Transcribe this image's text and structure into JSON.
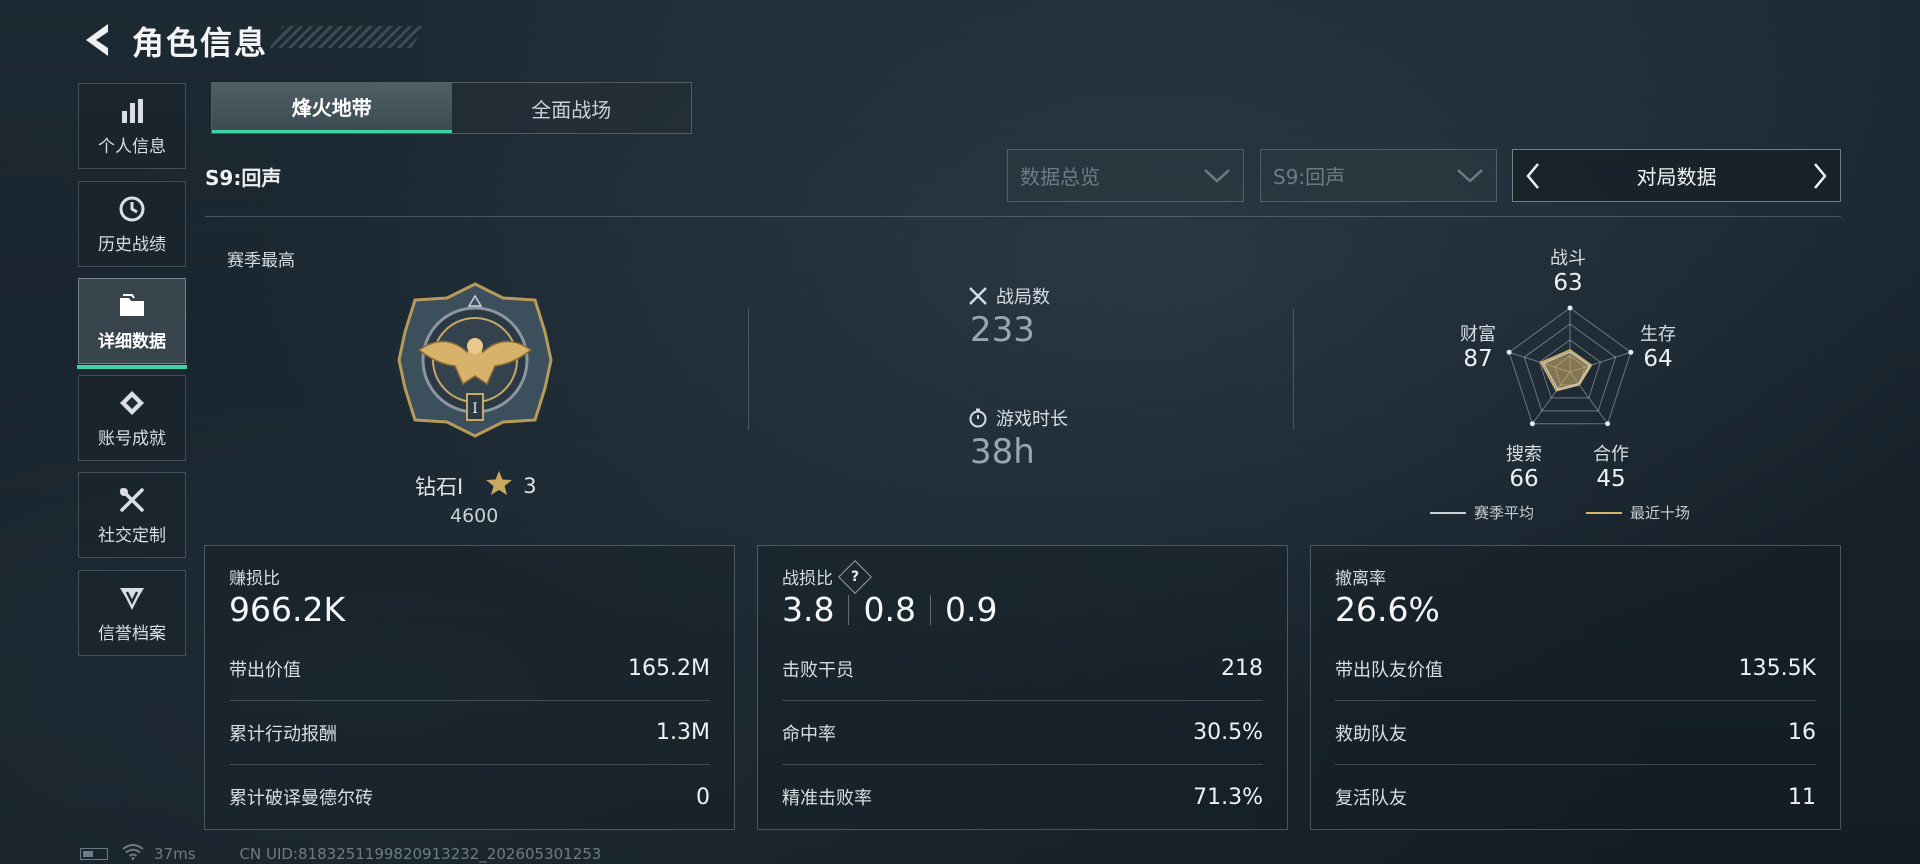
{
  "header": {
    "title": "角色信息"
  },
  "sidebar": {
    "items": [
      {
        "label": "个人信息",
        "icon": "bar-chart-icon"
      },
      {
        "label": "历史战绩",
        "icon": "clock-icon"
      },
      {
        "label": "详细数据",
        "icon": "folder-icon",
        "active": true
      },
      {
        "label": "账号成就",
        "icon": "achievement-icon"
      },
      {
        "label": "社交定制",
        "icon": "tools-icon"
      },
      {
        "label": "信誉档案",
        "icon": "shield-emblem-icon"
      }
    ]
  },
  "mode_tabs": [
    {
      "label": "烽火地带",
      "active": true
    },
    {
      "label": "全面战场",
      "active": false
    }
  ],
  "season": {
    "label": "S9:回声"
  },
  "filters": {
    "category": "数据总览",
    "season": "S9:回声",
    "nav_label": "对局数据"
  },
  "summary": {
    "season_best_label": "赛季最高",
    "rank_name": "钻石Ⅰ",
    "rank_stars": "3",
    "rank_points": "4600",
    "matches_label": "战局数",
    "matches_value": "233",
    "playtime_label": "游戏时长",
    "playtime_value": "38h"
  },
  "radar": {
    "axes": [
      {
        "label": "战斗",
        "value": "63"
      },
      {
        "label": "生存",
        "value": "64"
      },
      {
        "label": "合作",
        "value": "45"
      },
      {
        "label": "搜索",
        "value": "66"
      },
      {
        "label": "财富",
        "value": "87"
      }
    ],
    "legend": [
      {
        "label": "赛季平均",
        "color": "#c9d0d5"
      },
      {
        "label": "最近十场",
        "color": "#d8b46a"
      }
    ]
  },
  "panels": [
    {
      "title": "赚损比",
      "value": "966.2K",
      "rows": [
        {
          "label": "带出价值",
          "value": "165.2M"
        },
        {
          "label": "累计行动报酬",
          "value": "1.3M"
        },
        {
          "label": "累计破译曼德尔砖",
          "value": "0"
        }
      ]
    },
    {
      "title": "战损比",
      "values": [
        "3.8",
        "0.8",
        "0.9"
      ],
      "rows": [
        {
          "label": "击败干员",
          "value": "218"
        },
        {
          "label": "命中率",
          "value": "30.5%"
        },
        {
          "label": "精准击败率",
          "value": "71.3%"
        }
      ]
    },
    {
      "title": "撤离率",
      "value": "26.6%",
      "rows": [
        {
          "label": "带出队友价值",
          "value": "135.5K"
        },
        {
          "label": "救助队友",
          "value": "16"
        },
        {
          "label": "复活队友",
          "value": "11"
        }
      ]
    }
  ],
  "status": {
    "ping": "37ms",
    "uid": "CN UID:8183251199820913232_202605301253"
  },
  "colors": {
    "accent": "#3fd3a4",
    "gold": "#d8b46a"
  }
}
